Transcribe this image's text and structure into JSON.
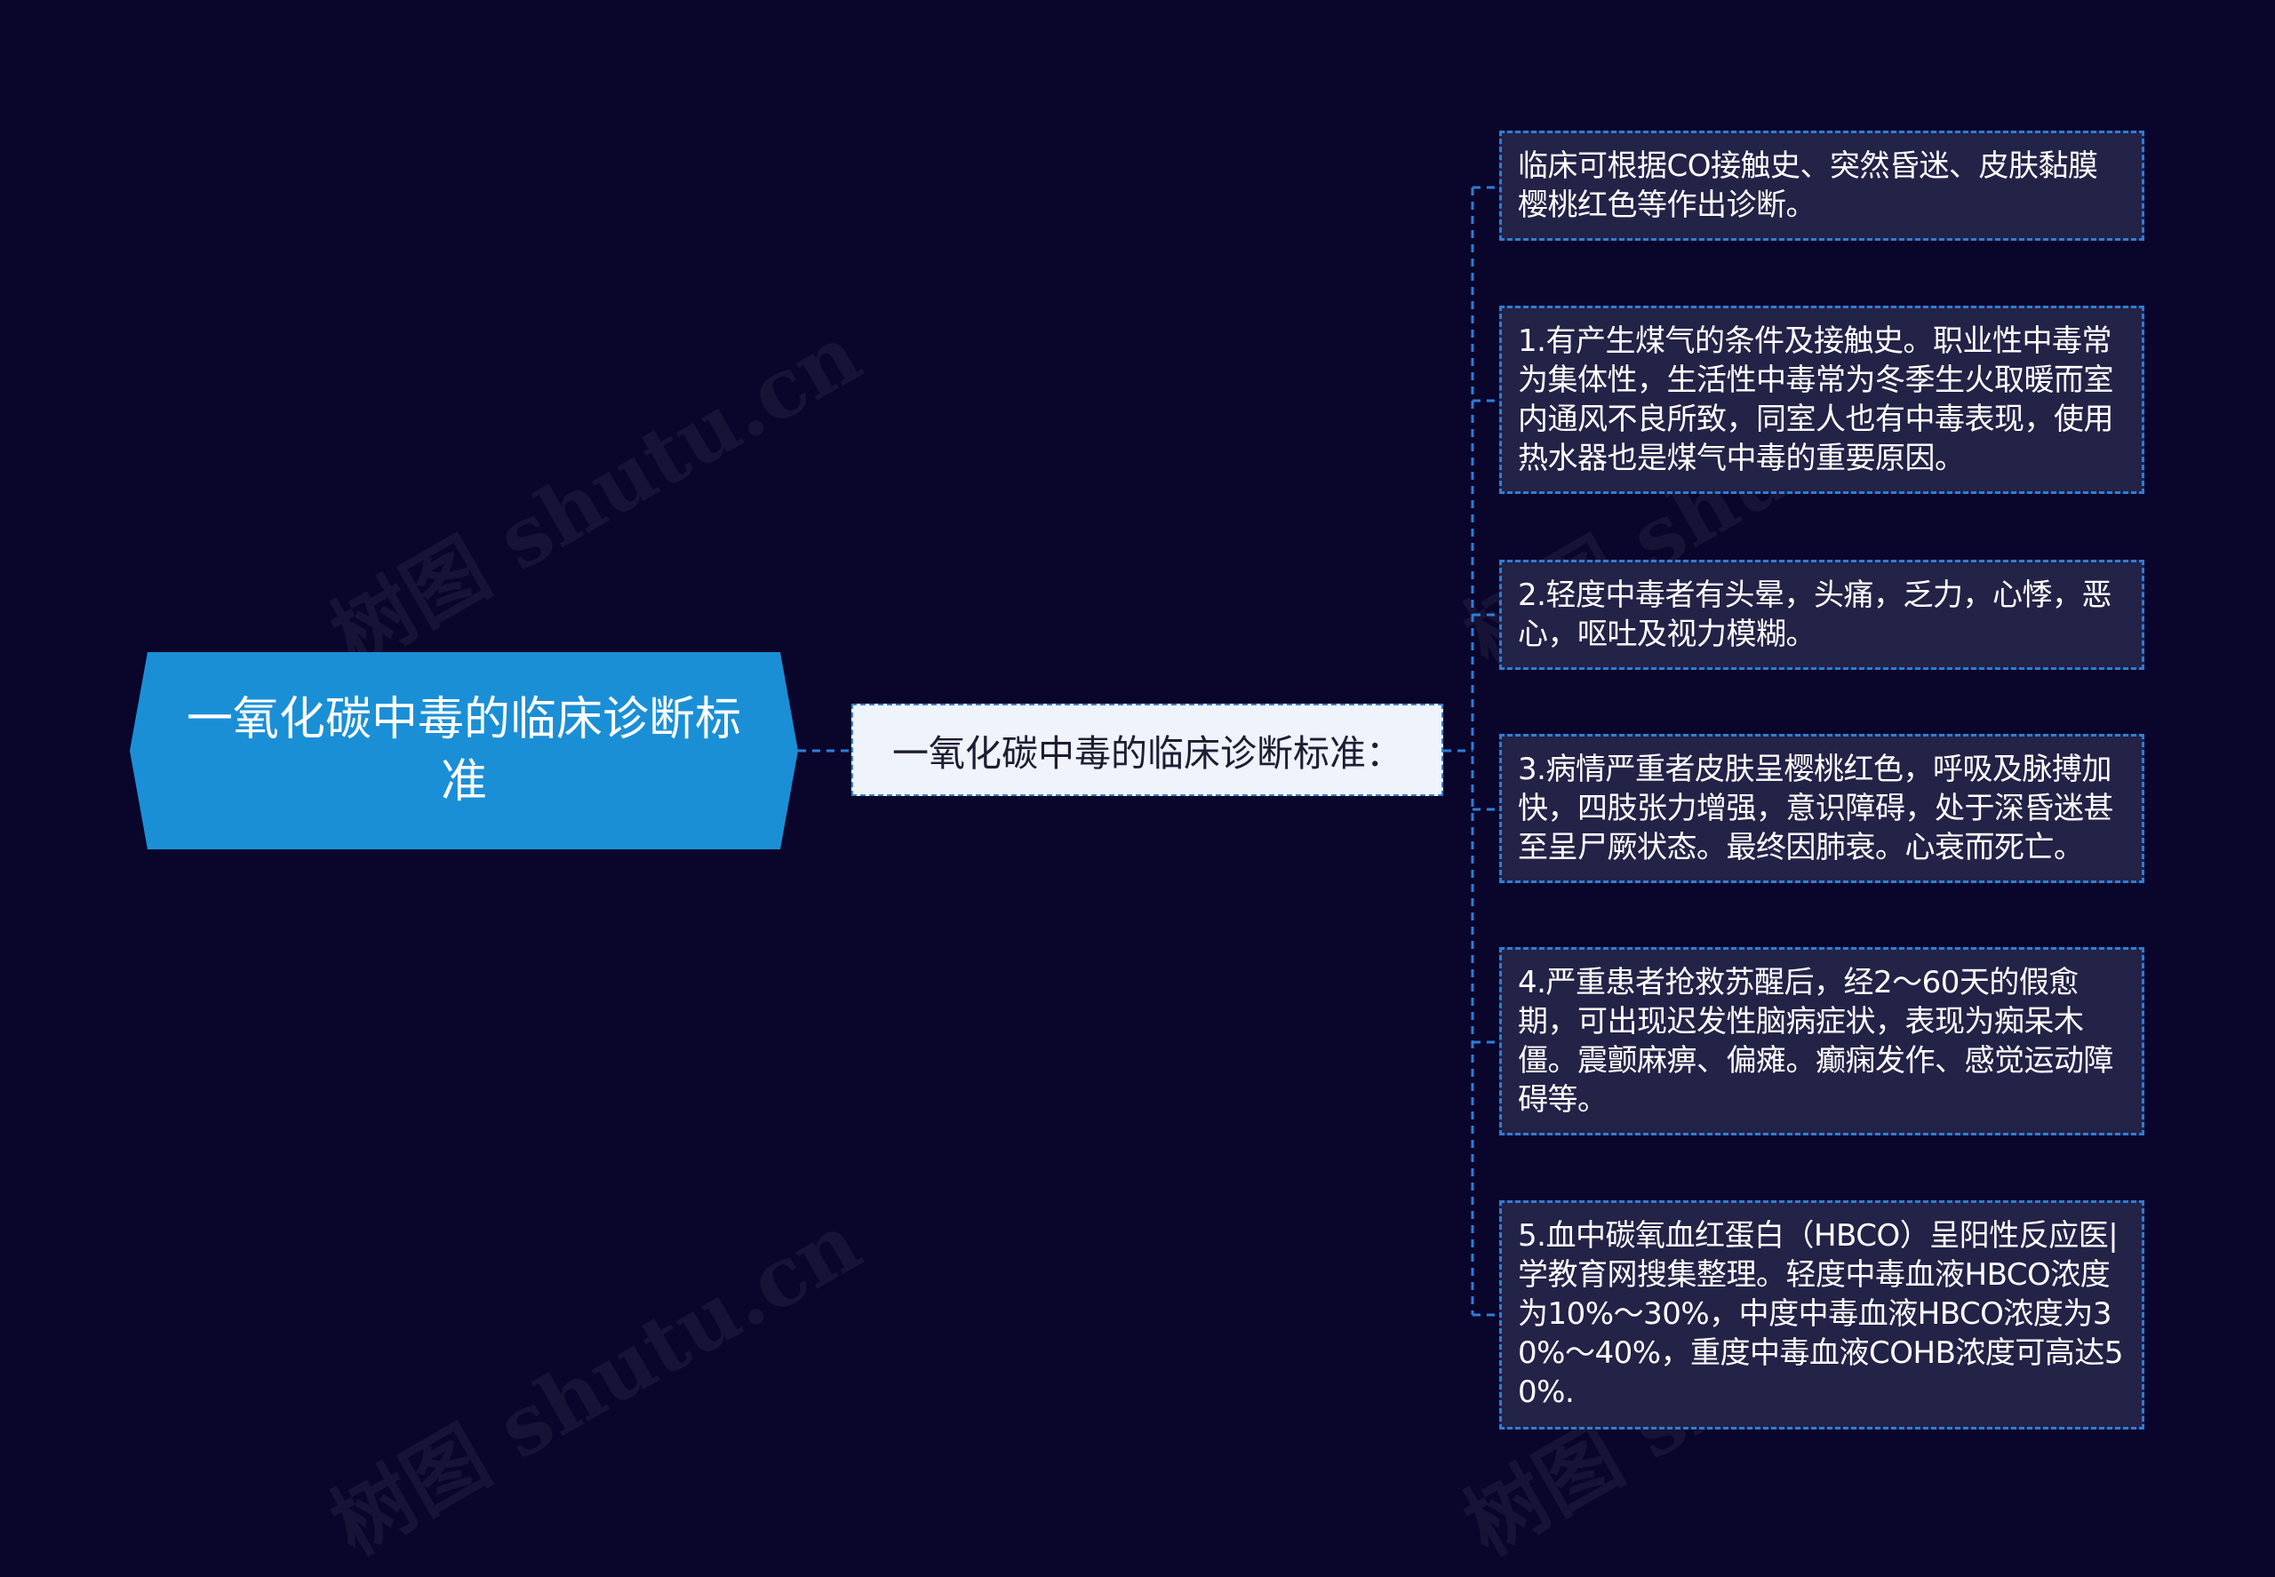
{
  "root": {
    "title": "一氧化碳中毒的临床诊断标准"
  },
  "branch": {
    "title": "一氧化碳中毒的临床诊断标准："
  },
  "leaves": [
    {
      "text": "临床可根据CO接触史、突然昏迷、皮肤黏膜樱桃红色等作出诊断。"
    },
    {
      "text": "1.有产生煤气的条件及接触史。职业性中毒常为集体性，生活性中毒常为冬季生火取暖而室内通风不良所致，同室人也有中毒表现，使用热水器也是煤气中毒的重要原因。"
    },
    {
      "text": "2.轻度中毒者有头晕，头痛，乏力，心悸，恶心，呕吐及视力模糊。"
    },
    {
      "text": "3.病情严重者皮肤呈樱桃红色，呼吸及脉搏加快，四肢张力增强，意识障碍，处于深昏迷甚至呈尸厥状态。最终因肺衰。心衰而死亡。"
    },
    {
      "text": "4.严重患者抢救苏醒后，经2～60天的假愈期，可出现迟发性脑病症状，表现为痴呆木僵。震颤麻痹、偏瘫。癫痫发作、感觉运动障碍等。"
    },
    {
      "text": "5.血中碳氧血红蛋白（HBCO）呈阳性反应医|学教育网搜集整理。轻度中毒血液HBCO浓度为10%～30%，中度中毒血液HBCO浓度为30%～40%，重度中毒血液COHB浓度可高达50%."
    }
  ],
  "watermark": "树图 shutu.cn",
  "colors": {
    "background": "#0a062b",
    "root_fill": "#1b8fd6",
    "branch_fill": "#eef3fc",
    "leaf_fill": "#232247",
    "connector": "#2d7dd8"
  }
}
